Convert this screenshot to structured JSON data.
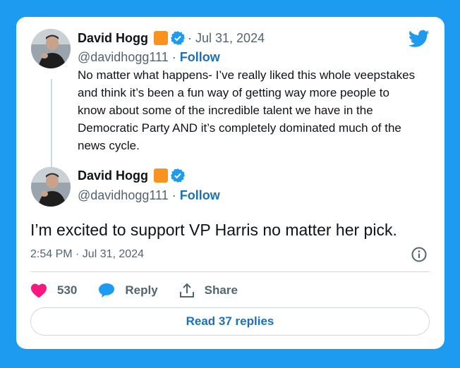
{
  "brand": {
    "logo_icon": "twitter-bird-icon",
    "accent_color": "#1d9bf0",
    "link_color": "#1d70b8",
    "like_color": "#f91880"
  },
  "quoted_tweet": {
    "author_name": "David Hogg",
    "handle": "@davidhogg111",
    "separator": " · ",
    "follow_label": "Follow",
    "date": "· Jul 31, 2024",
    "text": "No matter what happens- I’ve really liked this whole veepstakes and think it’s been a fun way of getting way more people to know about some of the incredible talent we have in the Democratic Party AND it’s completely dominated much of the news cycle."
  },
  "main_tweet": {
    "author_name": "David Hogg",
    "handle": "@davidhogg111",
    "separator": " · ",
    "follow_label": "Follow",
    "text": "I’m excited to support VP Harris no matter her pick.",
    "timestamp": "2:54 PM · Jul 31, 2024"
  },
  "actions": {
    "like_count": "530",
    "reply_label": "Reply",
    "share_label": "Share"
  },
  "read_replies_label": "Read 37 replies"
}
